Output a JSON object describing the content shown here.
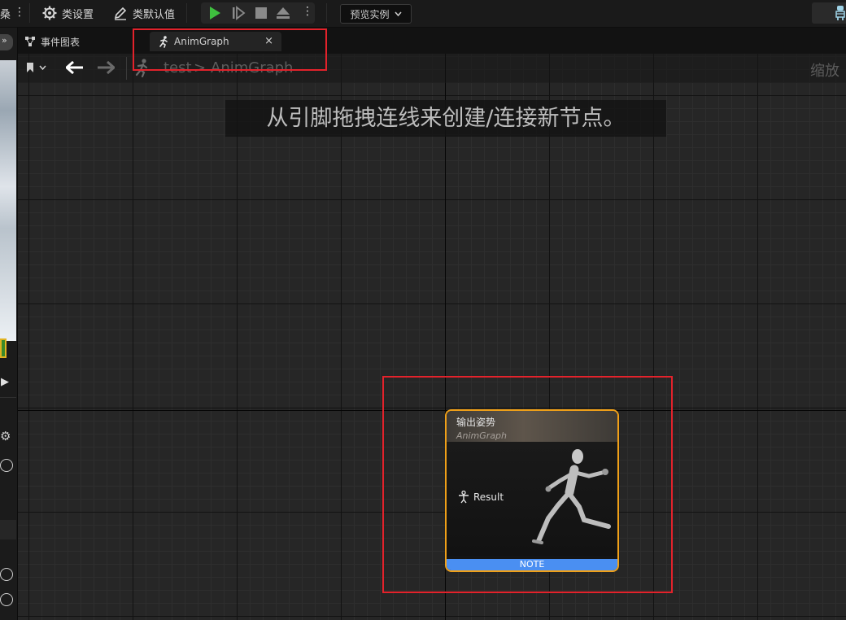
{
  "toolbar": {
    "left_cut_text": "桑",
    "class_settings": "类设置",
    "class_defaults": "类默认值",
    "preview_instance": "预览实例"
  },
  "tabs": [
    {
      "label": "事件图表",
      "active": false
    },
    {
      "label": "AnimGraph",
      "active": true,
      "close": "×"
    }
  ],
  "breadcrumb": {
    "root": "test",
    "separator": ">",
    "current": "AnimGraph",
    "zoom_label": "缩放"
  },
  "hint": "从引脚拖拽连线来创建/连接新节点。",
  "node": {
    "title": "输出姿势",
    "subtitle": "AnimGraph",
    "pin_label": "Result",
    "footer": "NOTE"
  },
  "colors": {
    "play": "#3fbf3f",
    "node_border": "#f0a018",
    "footer": "#4a8ff2",
    "annotation": "#e3222b"
  }
}
